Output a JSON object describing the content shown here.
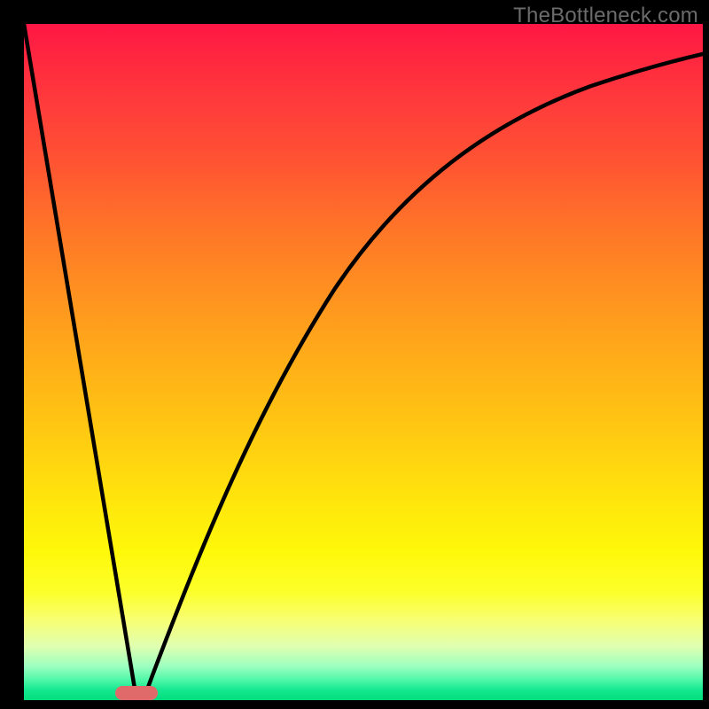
{
  "watermark": "TheBottleneck.com",
  "colors": {
    "frame": "#000000",
    "gradient_top": "#FF1744",
    "gradient_bottom": "#02DD7C",
    "curve": "#000000",
    "marker": "#E06A6A"
  },
  "chart_data": {
    "type": "line",
    "title": "",
    "xlabel": "",
    "ylabel": "",
    "xlim": [
      0,
      100
    ],
    "ylim": [
      0,
      100
    ],
    "note": "Curve depicts a score that drops to 0 at x≈16 then rises toward an asymptote near y≈100 with diminishing slope. Background gradient maps y to color: red (high) → yellow (mid) → green (low).",
    "series": [
      {
        "name": "curve",
        "x": [
          0,
          4,
          8,
          12,
          14,
          16,
          18,
          20,
          22,
          24,
          28,
          32,
          36,
          40,
          45,
          50,
          55,
          60,
          65,
          70,
          75,
          80,
          85,
          90,
          95,
          100
        ],
        "y": [
          100,
          77,
          53,
          25,
          10,
          0,
          10,
          19,
          27,
          34,
          45,
          54,
          61,
          67,
          73,
          78,
          82,
          85,
          87,
          89,
          90.5,
          92,
          93,
          94,
          94.8,
          95.5
        ]
      }
    ],
    "annotations": [
      {
        "name": "minimum-marker",
        "x": 16.5,
        "y": 0,
        "shape": "rounded-rect",
        "color": "#E06A6A"
      }
    ]
  }
}
